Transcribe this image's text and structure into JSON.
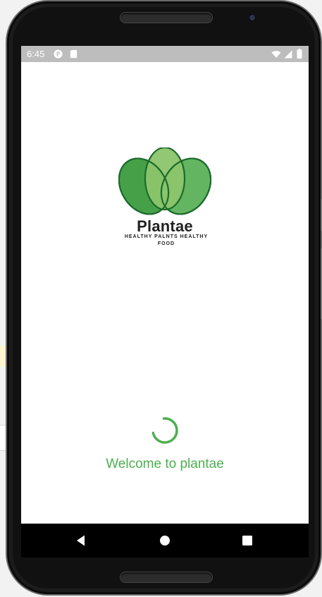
{
  "status_bar": {
    "time": "6:45",
    "icons": [
      "parking-notification-icon",
      "sd-card-icon",
      "wifi-icon",
      "cell-signal-icon",
      "battery-icon"
    ]
  },
  "brand": {
    "name": "Plantae",
    "tagline": "HEALTHY PALNTS HEALTHY FOOD",
    "colors": {
      "leaf_dark": "#3f9a3f",
      "leaf_mid": "#52ab4f",
      "leaf_light": "#8cc56b",
      "outline": "#1b6b2c"
    }
  },
  "loading": {
    "indicator": "circular-progress",
    "color": "#4caf50"
  },
  "welcome_text": "Welcome to plantae",
  "nav_bar": {
    "buttons": [
      "back",
      "home",
      "recents"
    ]
  }
}
